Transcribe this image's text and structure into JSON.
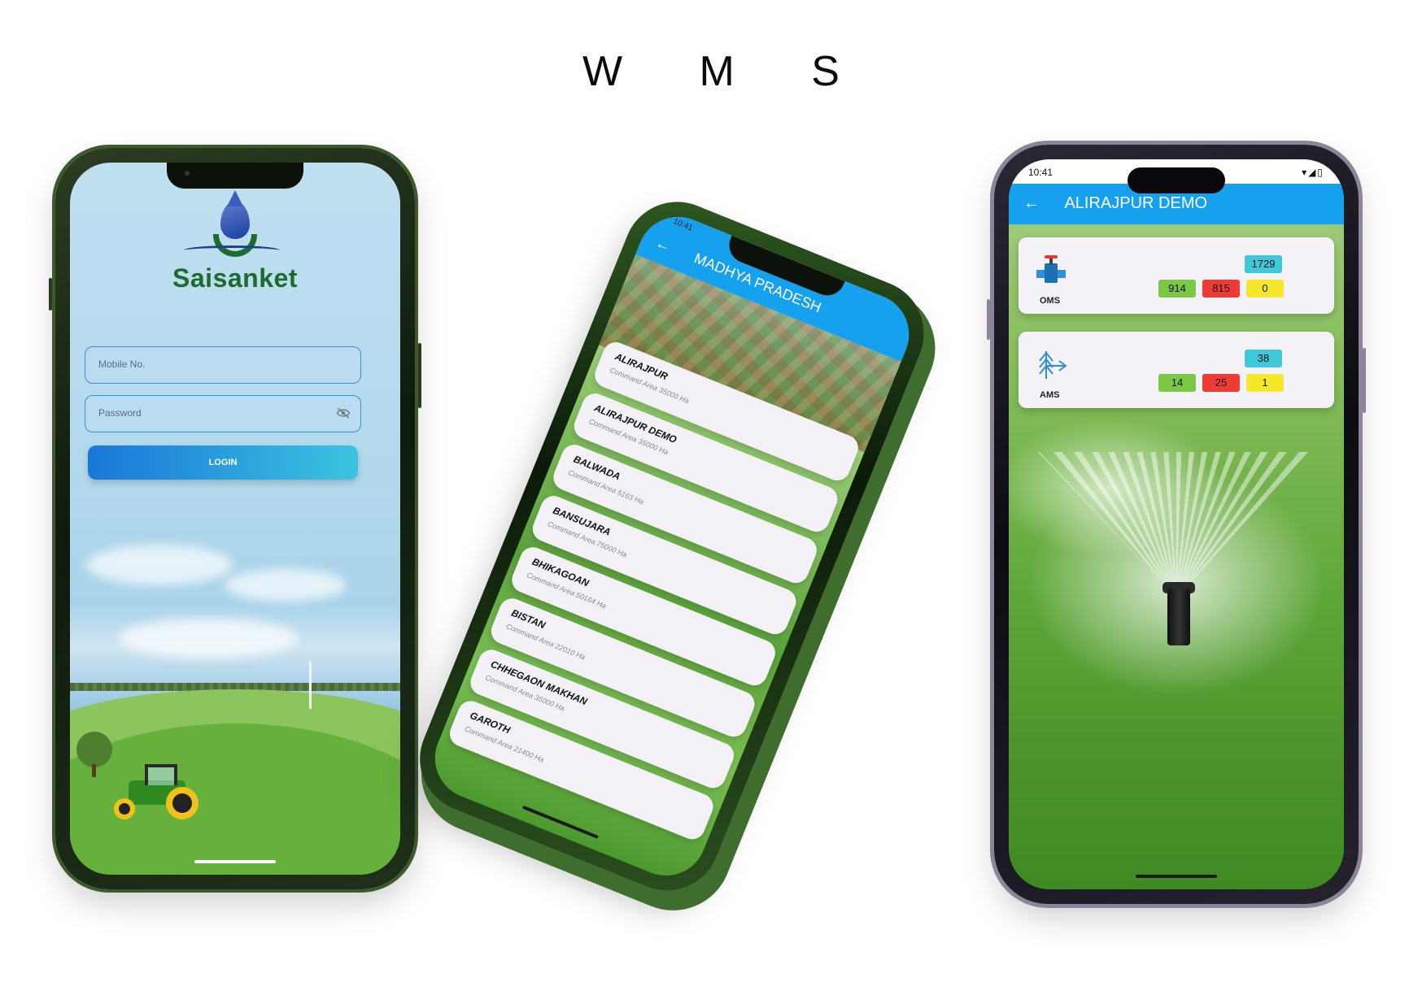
{
  "page": {
    "title": "W M S"
  },
  "login_screen": {
    "brand": "Saisanket",
    "mobile_placeholder": "Mobile No.",
    "password_placeholder": "Password",
    "login_label": "LOGIN",
    "password_visibility_icon": "eye-off-icon"
  },
  "list_screen": {
    "status_time": "10:41",
    "title": "MADHYA PRADESH",
    "items": [
      {
        "name": "ALIRAJPUR",
        "area": "Command Area 35000 Ha"
      },
      {
        "name": "ALIRAJPUR DEMO",
        "area": "Command Area 35000 Ha"
      },
      {
        "name": "BALWADA",
        "area": "Command Area 5163 Ha"
      },
      {
        "name": "BANSUJARA",
        "area": "Command Area 75000 Ha"
      },
      {
        "name": "BHIKAGOAN",
        "area": "Command Area 50164 Ha"
      },
      {
        "name": "BISTAN",
        "area": "Command Area 22010 Ha"
      },
      {
        "name": "CHHEGAON MAKHAN",
        "area": "Command Area 35000 Ha"
      },
      {
        "name": "GAROTH",
        "area": "Command Area 21400 Ha"
      }
    ]
  },
  "dashboard_screen": {
    "status_time": "10:41",
    "title": "ALIRAJPUR DEMO",
    "cards": [
      {
        "label": "OMS",
        "icon": "valve-icon",
        "total": "1729",
        "green": "914",
        "red": "815",
        "yellow": "0"
      },
      {
        "label": "AMS",
        "icon": "antenna-icon",
        "total": "38",
        "green": "14",
        "red": "25",
        "yellow": "1"
      }
    ]
  },
  "colors": {
    "app_bar": "#16a1ee",
    "brand_green": "#1d6c2e",
    "badge_cyan": "#3ec9d9",
    "badge_green": "#7cc743",
    "badge_red": "#ee3b35",
    "badge_yellow": "#f5e72b"
  }
}
